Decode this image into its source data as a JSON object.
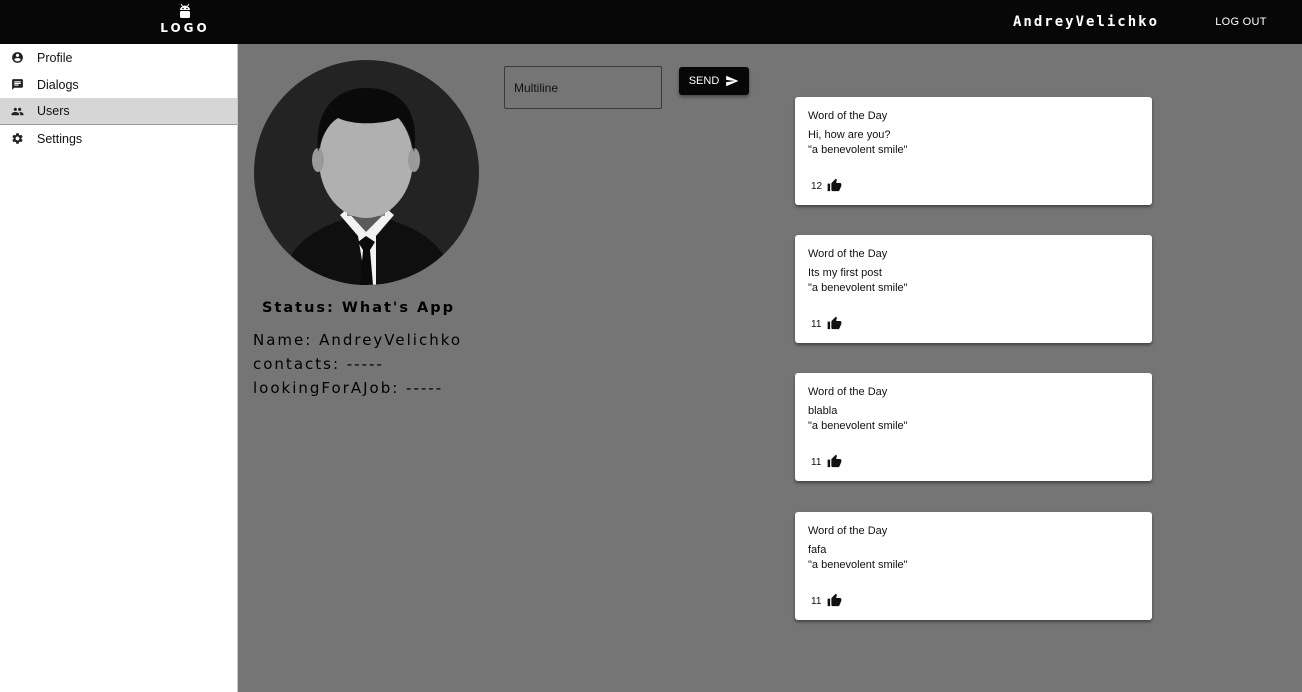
{
  "header": {
    "logo_text": "LOGO",
    "username": "AndreyVelichko",
    "logout_label": "LOG OUT"
  },
  "sidebar": {
    "items": [
      {
        "label": "Profile",
        "icon": "account-circle-icon"
      },
      {
        "label": "Dialogs",
        "icon": "chat-icon"
      },
      {
        "label": "Users",
        "icon": "people-icon",
        "active": true
      },
      {
        "label": "Settings",
        "icon": "gear-icon"
      }
    ]
  },
  "profile": {
    "status": "Status: What's App",
    "name": "Name: AndreyVelichko",
    "contacts": "contacts: -----",
    "looking_for_job": "lookingForAJob: -----"
  },
  "composer": {
    "placeholder": "Multiline",
    "send_label": "SEND"
  },
  "posts": [
    {
      "title": "Word of the Day",
      "message": "Hi, how are you?",
      "quote": "\"a benevolent smile\"",
      "likes": "12"
    },
    {
      "title": "Word of the Day",
      "message": "Its my first post",
      "quote": "\"a benevolent smile\"",
      "likes": "11"
    },
    {
      "title": "Word of the Day",
      "message": "blabla",
      "quote": "\"a benevolent smile\"",
      "likes": "11"
    },
    {
      "title": "Word of the Day",
      "message": "fafa",
      "quote": "\"a benevolent smile\"",
      "likes": "11"
    }
  ],
  "colors": {
    "topbar": "#070707",
    "content_bg": "#757575",
    "active_nav": "#d6d6d6"
  }
}
